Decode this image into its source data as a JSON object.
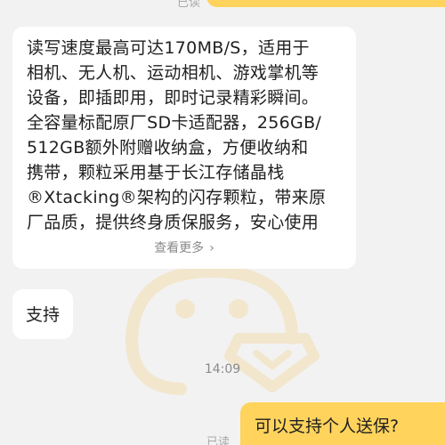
{
  "top_read_status": "已读",
  "product_message": {
    "lines": [
      "读写速度最高可达170MB/S，适用于",
      "相机、无人机、运动相机、游戏掌机等",
      "设备，即插即用，即时记录精彩瞬间。",
      "全容量标配原厂SD卡适配器，256GB/",
      "512GB额外附赠收纳盒，方便收纳和",
      "携带，颗粒采用基于长江存储晶栈",
      "®Xtacking®架构的闪存颗粒，带来原",
      "厂品质，提供终身质保服务，安心使用"
    ],
    "see_more": "查看更多"
  },
  "support_message": "支持",
  "timestamp": "14:09",
  "outgoing_message": "可以支持个人送保?",
  "bottom_read_status": "已读",
  "colors": {
    "background": "#f2f2f2",
    "incoming_bubble": "#ffffff",
    "outgoing_bubble": "#ffd35c",
    "watermark": "#f6e2b8"
  },
  "icons": {
    "see_more": "chevron-right-icon",
    "watermark": "mascot-watermark-icon"
  }
}
